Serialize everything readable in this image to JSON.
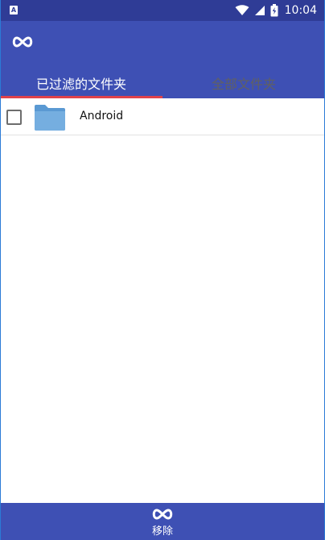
{
  "status_bar": {
    "left_icon": "A",
    "icons": [
      "wifi-icon",
      "signal-icon",
      "battery-charging-icon"
    ],
    "time": "10:04"
  },
  "app_bar": {
    "logo": "infinity-logo-icon",
    "tabs": [
      {
        "label": "已过滤的文件夹",
        "active": true
      },
      {
        "label": "全部文件夹",
        "active": false
      }
    ]
  },
  "list": {
    "items": [
      {
        "label": "Android",
        "checked": false,
        "icon": "folder-icon"
      }
    ]
  },
  "bottom_bar": {
    "icon": "infinity-logo-icon",
    "label": "移除"
  },
  "colors": {
    "primary": "#3e50b4",
    "status_bar": "#2f3c96",
    "tab_indicator": "#e0424b",
    "folder": "#75aee0"
  }
}
